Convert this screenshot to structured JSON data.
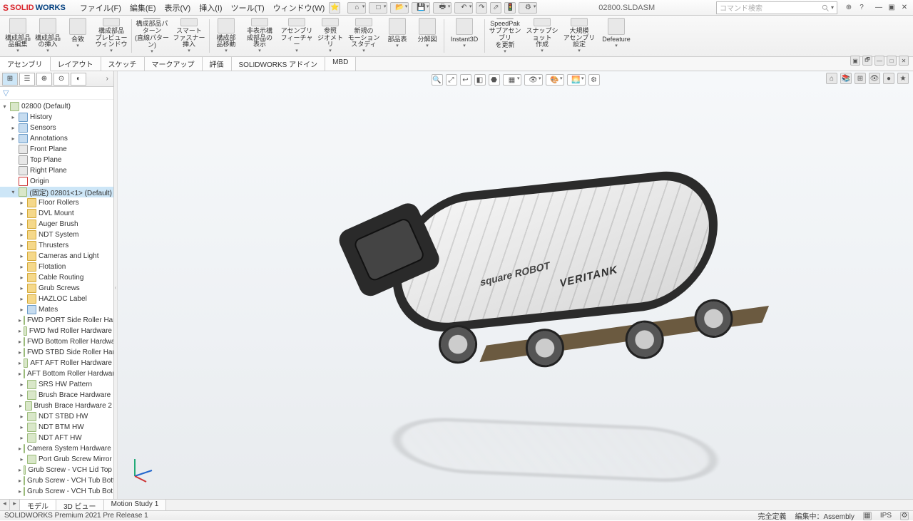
{
  "title_doc": "02800.SLDASM",
  "menu": [
    "ファイル(F)",
    "編集(E)",
    "表示(V)",
    "挿入(I)",
    "ツール(T)",
    "ウィンドウ(W)"
  ],
  "search_placeholder": "コマンド検索",
  "ribbon": [
    {
      "label": "構成部品\n品編集"
    },
    {
      "label": "構成部品\nの挿入"
    },
    {
      "label": "合致"
    },
    {
      "label": "構成部品\nプレビュー\nウィンドウ"
    },
    {
      "label": "構成部品パターン\n(直線パターン)"
    },
    {
      "label": "スマート\nファスナー\n挿入"
    },
    {
      "label": "構成部\n品移動"
    },
    {
      "label": "非表示構\n成部品の\n表示"
    },
    {
      "label": "アセンブリ\nフィーチャー"
    },
    {
      "label": "参照\nジオメトリ"
    },
    {
      "label": "新規の\nモーション\nスタディ"
    },
    {
      "label": "部品表"
    },
    {
      "label": "分解図"
    },
    {
      "label": "Instant3D"
    },
    {
      "label": "SpeedPak\nサブアセンブリ\nを更新"
    },
    {
      "label": "スナップショット\n作成"
    },
    {
      "label": "大規模\nアセンブリ\n設定"
    },
    {
      "label": "Defeature"
    }
  ],
  "cmd_tabs": [
    "アセンブリ",
    "レイアウト",
    "スケッチ",
    "マークアップ",
    "評価",
    "SOLIDWORKS アドイン",
    "MBD"
  ],
  "cmd_active": 0,
  "feature_tree_root": "02800 (Default)",
  "feature_tree": [
    {
      "t": "▸",
      "icon": "feat",
      "label": "History",
      "ind": 1
    },
    {
      "t": "▸",
      "icon": "feat",
      "label": "Sensors",
      "ind": 1
    },
    {
      "t": "▸",
      "icon": "feat",
      "label": "Annotations",
      "ind": 1
    },
    {
      "t": "",
      "icon": "plane",
      "label": "Front Plane",
      "ind": 1
    },
    {
      "t": "",
      "icon": "plane",
      "label": "Top Plane",
      "ind": 1
    },
    {
      "t": "",
      "icon": "plane",
      "label": "Right Plane",
      "ind": 1
    },
    {
      "t": "",
      "icon": "orig",
      "label": "Origin",
      "ind": 1
    },
    {
      "t": "▾",
      "icon": "part",
      "label": "(固定) 02801<1> (Default)",
      "ind": 1,
      "sel": true
    },
    {
      "t": "▸",
      "icon": "folder",
      "label": "Floor Rollers",
      "ind": 2
    },
    {
      "t": "▸",
      "icon": "folder",
      "label": "DVL Mount",
      "ind": 2
    },
    {
      "t": "▸",
      "icon": "folder",
      "label": "Auger Brush",
      "ind": 2
    },
    {
      "t": "▸",
      "icon": "folder",
      "label": "NDT System",
      "ind": 2
    },
    {
      "t": "▸",
      "icon": "folder",
      "label": "Thrusters",
      "ind": 2
    },
    {
      "t": "▸",
      "icon": "folder",
      "label": "Cameras and Light",
      "ind": 2
    },
    {
      "t": "▸",
      "icon": "folder",
      "label": "Flotation",
      "ind": 2
    },
    {
      "t": "▸",
      "icon": "folder",
      "label": "Cable Routing",
      "ind": 2
    },
    {
      "t": "▸",
      "icon": "folder",
      "label": "Grub Screws",
      "ind": 2
    },
    {
      "t": "▸",
      "icon": "folder",
      "label": "HAZLOC Label",
      "ind": 2
    },
    {
      "t": "▸",
      "icon": "feat",
      "label": "Mates",
      "ind": 2
    },
    {
      "t": "▸",
      "icon": "part",
      "label": "FWD PORT Side Roller Hardware",
      "ind": 2
    },
    {
      "t": "▸",
      "icon": "part",
      "label": "FWD fwd Roller Hardware",
      "ind": 2
    },
    {
      "t": "▸",
      "icon": "part",
      "label": "FWD Bottom Roller Hardware",
      "ind": 2
    },
    {
      "t": "▸",
      "icon": "part",
      "label": "FWD STBD Side Roller Hardware",
      "ind": 2
    },
    {
      "t": "▸",
      "icon": "part",
      "label": "AFT AFT Roller Hardware",
      "ind": 2
    },
    {
      "t": "▸",
      "icon": "part",
      "label": "AFT Bottom Roller Hardware H",
      "ind": 2
    },
    {
      "t": "▸",
      "icon": "part",
      "label": "SRS HW Pattern",
      "ind": 2
    },
    {
      "t": "▸",
      "icon": "part",
      "label": "Brush Brace Hardware",
      "ind": 2
    },
    {
      "t": "▸",
      "icon": "part",
      "label": "Brush Brace Hardware 2",
      "ind": 2
    },
    {
      "t": "▸",
      "icon": "part",
      "label": "NDT STBD HW",
      "ind": 2
    },
    {
      "t": "▸",
      "icon": "part",
      "label": "NDT BTM HW",
      "ind": 2
    },
    {
      "t": "▸",
      "icon": "part",
      "label": "NDT AFT HW",
      "ind": 2
    },
    {
      "t": "▸",
      "icon": "part",
      "label": "Camera System Hardware Patte",
      "ind": 2
    },
    {
      "t": "▸",
      "icon": "part",
      "label": "Port Grub Screw Mirror",
      "ind": 2
    },
    {
      "t": "▸",
      "icon": "part",
      "label": "Grub Screw - VCH Lid Top",
      "ind": 2
    },
    {
      "t": "▸",
      "icon": "part",
      "label": "Grub Screw - VCH Tub Bottom",
      "ind": 2
    },
    {
      "t": "▸",
      "icon": "part",
      "label": "Grub Screw - VCH Tub Bot - Le",
      "ind": 2
    }
  ],
  "doc_tabs": [
    "モデル",
    "3D ビュー",
    "Motion Study 1"
  ],
  "doc_tab_active": 0,
  "status_left": "SOLIDWORKS Premium 2021 Pre Release 1",
  "status_right": [
    "完全定義",
    "編集中：Assembly",
    "IPS"
  ],
  "decal1": "square\nROBOT",
  "decal2": "VERITANK"
}
